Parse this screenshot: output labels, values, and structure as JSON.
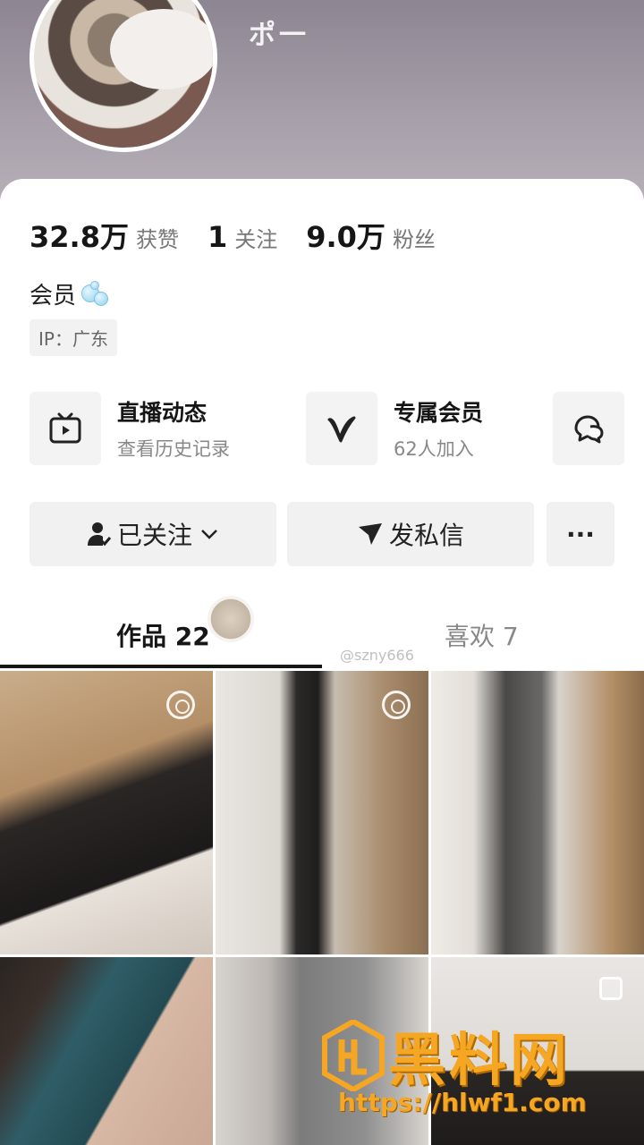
{
  "profile": {
    "name": "ポ一",
    "stats": [
      {
        "value": "32.8万",
        "label": "获赞"
      },
      {
        "value": "1",
        "label": "关注"
      },
      {
        "value": "9.0万",
        "label": "粉丝"
      }
    ],
    "member_label": "会员",
    "ip_label": "IP：广东"
  },
  "features": [
    {
      "icon": "tv-icon",
      "title": "直播动态",
      "subtitle": "查看历史记录"
    },
    {
      "icon": "v-logo-icon",
      "title": "专属会员",
      "subtitle": "62人加入"
    },
    {
      "icon": "chat-bubbles-icon",
      "title": "",
      "subtitle": ""
    }
  ],
  "actions": {
    "follow_label": "已关注",
    "message_label": "发私信",
    "more_label": "···"
  },
  "tabs": {
    "works_label": "作品 22",
    "likes_label": "喜欢 7",
    "watermark_user": "@szny666"
  },
  "colors": {
    "header_bg": "#a79fa9",
    "brand_orange": "#f5a623",
    "text_dark": "#161616",
    "text_grey": "#777777"
  },
  "watermark": {
    "brand_name": "黑料网",
    "url": "https://hlwf1.com"
  }
}
